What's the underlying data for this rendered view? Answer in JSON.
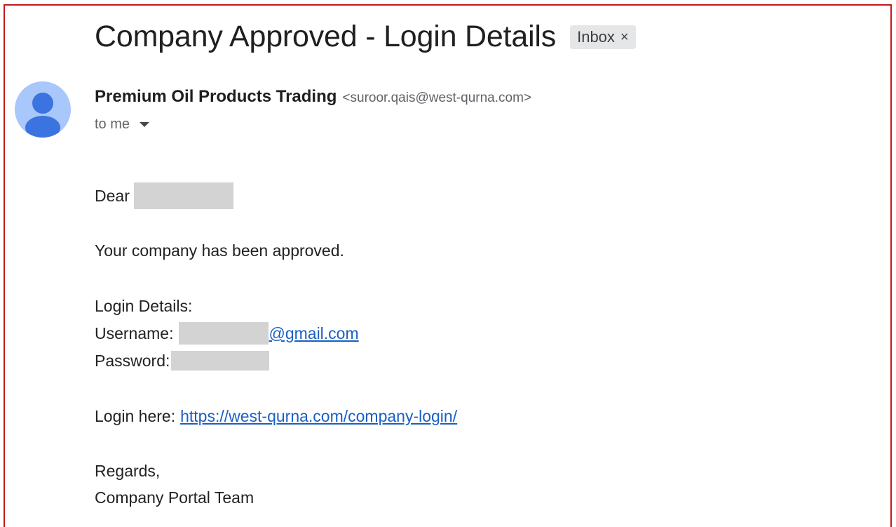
{
  "email": {
    "subject": "Company Approved - Login Details",
    "label_chip": "Inbox",
    "label_chip_close": "×",
    "sender": {
      "name": "Premium Oil Products Trading",
      "email": "<suroor.qais@west-qurna.com>"
    },
    "recipient_line": "to me",
    "body": {
      "greeting": "Dear",
      "line1": "Your company has been approved.",
      "login_heading": "Login Details:",
      "username_label": "Username:",
      "username_domain": "@gmail.com",
      "password_label": "Password:",
      "login_prefix": "Login here:",
      "login_url": "https://west-qurna.com/company-login/",
      "signoff": "Regards,",
      "signature": "Company Portal Team"
    }
  },
  "colors": {
    "frame_border": "#c41a1a",
    "avatar_bg": "#a8c7fa",
    "avatar_fg": "#3b74e0",
    "link": "#1a5fc4",
    "redaction": "#d3d3d3"
  },
  "icons": {
    "avatar": "person-icon",
    "recipient_toggle": "caret-down-icon",
    "chip_close": "close-icon"
  }
}
